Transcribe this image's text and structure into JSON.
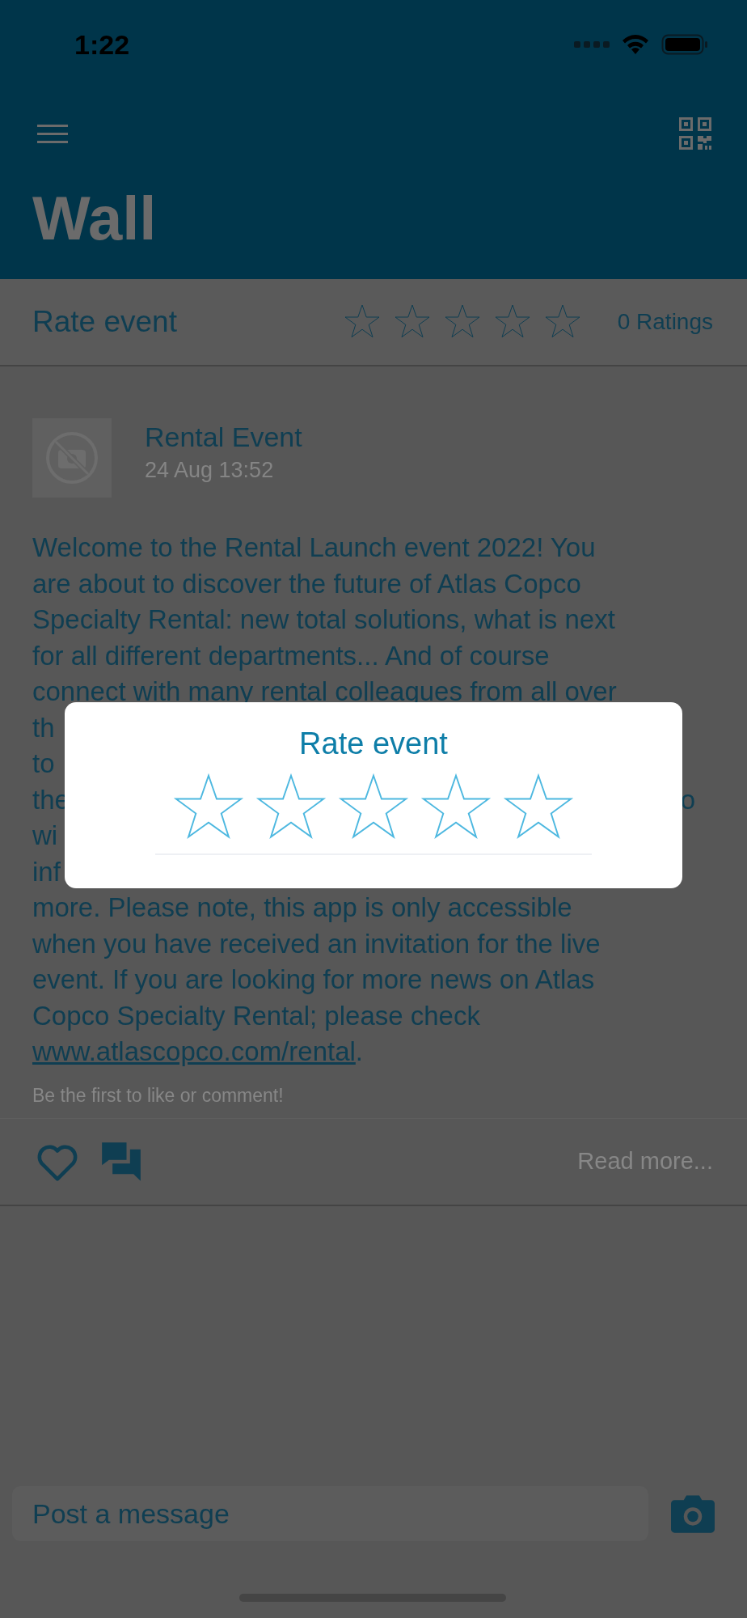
{
  "status_bar": {
    "time": "1:22"
  },
  "header": {
    "title": "Wall"
  },
  "rating_bar": {
    "label": "Rate event",
    "stars": 0,
    "count": "0 Ratings"
  },
  "post": {
    "author": "Rental Event",
    "date": "24 Aug 13:52",
    "lines": [
      {
        "kind": "full",
        "text": "Welcome to the Rental Launch event 2022! You"
      },
      {
        "kind": "full",
        "text": "are about to discover the future of Atlas Copco"
      },
      {
        "kind": "full",
        "text": "Specialty Rental: new total solutions, what is next"
      },
      {
        "kind": "full",
        "text": "for all different departments... And of course"
      },
      {
        "kind": "full",
        "text": "connect with many rental colleagues from all over"
      },
      {
        "kind": "split",
        "left": "th"
      },
      {
        "kind": "split",
        "left": "to"
      },
      {
        "kind": "split",
        "left": "the",
        "right": "o"
      },
      {
        "kind": "split",
        "left": "wi"
      },
      {
        "kind": "split",
        "left": "inf"
      },
      {
        "kind": "full",
        "text": "more. Please note, this app is only accessible"
      },
      {
        "kind": "full",
        "text": "when you have received an invitation for the live"
      },
      {
        "kind": "full",
        "text": "event. If you are looking for more news on Atlas"
      },
      {
        "kind": "full",
        "text": "Copco Specialty Rental; please check"
      },
      {
        "kind": "link",
        "link": "www.atlascopco.com/rental",
        "after": "."
      }
    ],
    "engagement": "Be the first to like or comment!",
    "liked": false,
    "read_more": "Read more..."
  },
  "composer": {
    "placeholder": "Post a message"
  },
  "dialog": {
    "title": "Rate event",
    "stars": 0
  }
}
